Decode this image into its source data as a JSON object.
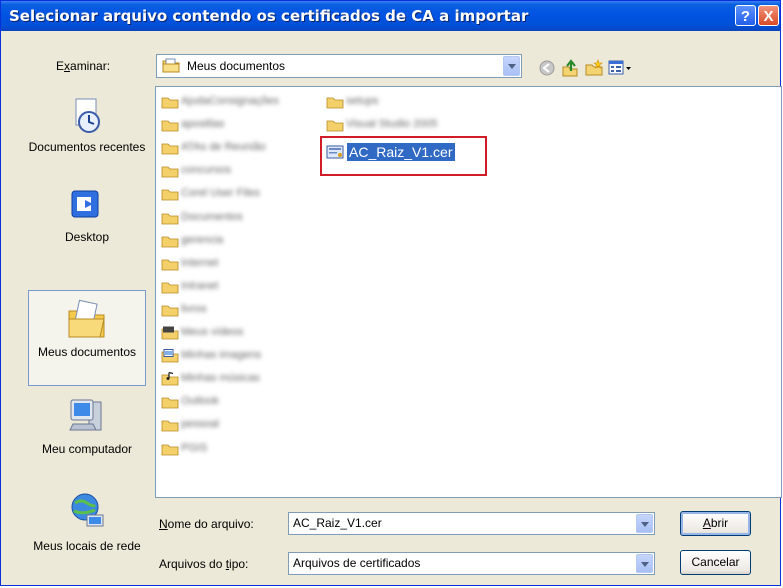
{
  "title": "Selecionar arquivo contendo os certificados de CA a importar",
  "titlebar_buttons": {
    "help": "?",
    "close": "X"
  },
  "lookin": {
    "label": "Examinar:",
    "value": "Meus documentos"
  },
  "places": [
    {
      "label": "Documentos recentes",
      "icon": "recent-documents-icon"
    },
    {
      "label": "Desktop",
      "icon": "desktop-icon"
    },
    {
      "label": "Meus documentos",
      "icon": "my-documents-icon"
    },
    {
      "label": "Meu computador",
      "icon": "my-computer-icon"
    },
    {
      "label": "Meus locais de rede",
      "icon": "network-places-icon"
    }
  ],
  "files": [
    {
      "name": "AjudaConsignações",
      "type": "folder"
    },
    {
      "name": "apostilas",
      "type": "folder"
    },
    {
      "name": "ATAs de Reunião",
      "type": "folder"
    },
    {
      "name": "concursos",
      "type": "folder"
    },
    {
      "name": "Corel User Files",
      "type": "folder"
    },
    {
      "name": "Documentos",
      "type": "folder"
    },
    {
      "name": "gerencia",
      "type": "folder"
    },
    {
      "name": "Internet",
      "type": "folder"
    },
    {
      "name": "Intranet",
      "type": "folder"
    },
    {
      "name": "livros",
      "type": "folder"
    },
    {
      "name": "Meus vídeos",
      "type": "video-folder"
    },
    {
      "name": "Minhas imagens",
      "type": "image-folder"
    },
    {
      "name": "Minhas músicas",
      "type": "music-folder"
    },
    {
      "name": "Outlook",
      "type": "folder"
    },
    {
      "name": "pessoal",
      "type": "folder"
    },
    {
      "name": "PGIS",
      "type": "folder"
    },
    {
      "name": "setups",
      "type": "folder"
    },
    {
      "name": "Visual Studio 2005",
      "type": "folder"
    },
    {
      "name": "AC_Raiz_V1.cer",
      "type": "certificate",
      "selected": true
    }
  ],
  "filename": {
    "label": "Nome do arquivo:",
    "value": "AC_Raiz_V1.cer"
  },
  "filetype": {
    "label": "Arquivos do tipo:",
    "value": "Arquivos de certificados"
  },
  "buttons": {
    "open": "Abrir",
    "cancel": "Cancelar"
  },
  "colors": {
    "selection": "#316ac5",
    "highlight_box": "#d11c28",
    "titlebar": "#0054e3"
  }
}
